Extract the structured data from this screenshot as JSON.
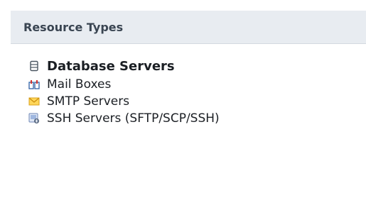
{
  "panel": {
    "title": "Resource Types"
  },
  "resource_types": [
    {
      "label": "Database Servers",
      "icon": "database-icon",
      "selected": true
    },
    {
      "label": "Mail Boxes",
      "icon": "mailbox-icon",
      "selected": false
    },
    {
      "label": "SMTP Servers",
      "icon": "envelope-icon",
      "selected": false
    },
    {
      "label": "SSH Servers (SFTP/SCP/SSH)",
      "icon": "ssh-server-icon",
      "selected": false
    }
  ],
  "colors": {
    "header_bg": "#e8ecf1",
    "title_text": "#3a4552",
    "item_text": "#1b1f24"
  }
}
